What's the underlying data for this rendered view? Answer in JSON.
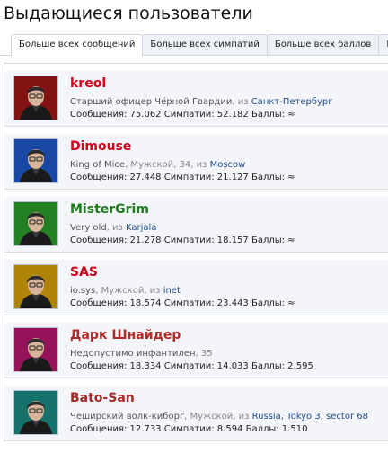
{
  "page": {
    "title": "Выдающиеся пользователи"
  },
  "tabs": [
    {
      "label": "Больше всех сообщений"
    },
    {
      "label": "Больше всех симпатий"
    },
    {
      "label": "Больше всех баллов"
    },
    {
      "label": "Ком"
    }
  ],
  "users": [
    {
      "name": "kreol",
      "name_color": "#d0021b",
      "title": "Старший офицер Чёрной Гвардии",
      "details": "",
      "from": ", из ",
      "location": "Санкт-Петербург",
      "stats": "Сообщения: 75.062 Симпатии: 52.182 Баллы: ≈",
      "avatar_bg": "#a01818"
    },
    {
      "name": "Dimouse",
      "name_color": "#d0021b",
      "title": "King of Mice",
      "details": ", Мужской, 34",
      "from": ", из ",
      "location": "Moscow",
      "stats": "Сообщения: 27.448 Симпатии: 21.127 Баллы: ≈",
      "avatar_bg": "#1f59c9"
    },
    {
      "name": "MisterGrim",
      "name_color": "#1f7a1f",
      "title": "Very old",
      "details": "",
      "from": ", из ",
      "location": "Karjala",
      "stats": "Сообщения: 21.278 Симпатии: 18.157 Баллы: ≈",
      "avatar_bg": "#2b9d2b"
    },
    {
      "name": "SAS",
      "name_color": "#d0021b",
      "title": "io.sys",
      "details": ", Мужской",
      "from": ", из ",
      "location": "inet",
      "stats": "Сообщения: 18.574 Симпатии: 23.443 Баллы: ≈",
      "avatar_bg": "#d6a10a"
    },
    {
      "name": "Дарк Шнайдер",
      "name_color": "#b02a2a",
      "title": "Недопустимо инфантилен",
      "details": ", 35",
      "from": "",
      "location": "",
      "stats": "Сообщения: 18.334 Симпатии: 14.033 Баллы: 2.595",
      "avatar_bg": "#b8186e"
    },
    {
      "name": "Bato-San",
      "name_color": "#a52a2a",
      "title": "Чеширский волк-киборг",
      "details": ", Мужской",
      "from": ", из ",
      "location": "Russia, Tokyo 3, sector 68",
      "stats": "Сообщения: 12.733 Симпатии: 8.594 Баллы: 1.510",
      "avatar_bg": "#1c8a82"
    }
  ]
}
